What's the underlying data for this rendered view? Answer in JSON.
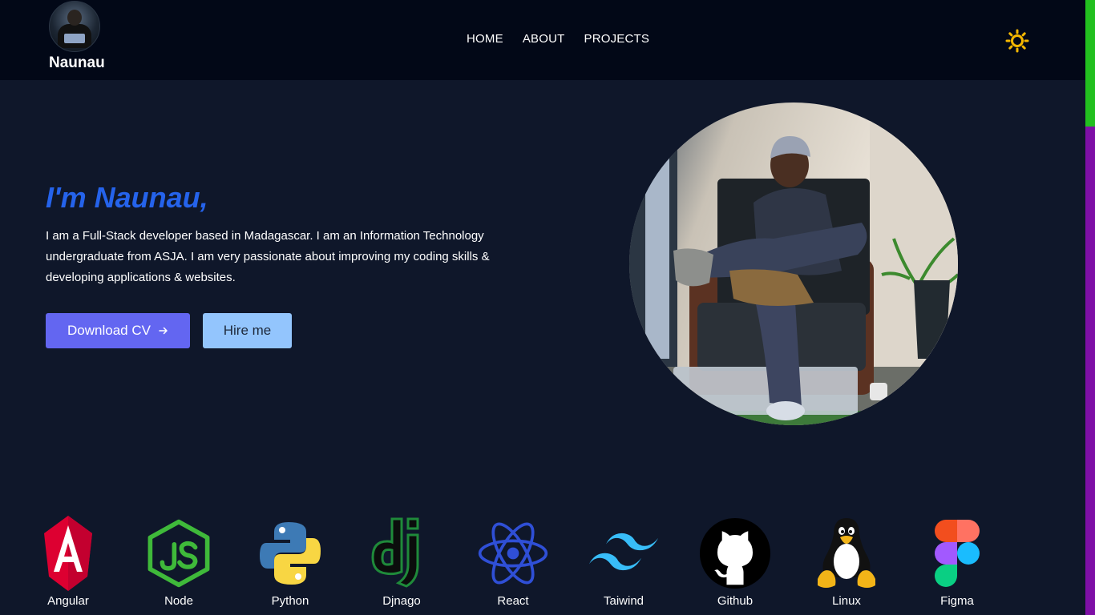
{
  "nav": {
    "brand_name": "Naunau",
    "links": [
      "HOME",
      "ABOUT",
      "PROJECTS"
    ]
  },
  "hero": {
    "title": "I'm Naunau,",
    "description": "I am a Full-Stack developer based in Madagascar. I am an Information Technology undergraduate from ASJA. I am very passionate about improving my coding skills & developing applications & websites.",
    "download_cv_label": "Download CV",
    "download_cv_icon": "arrow-right-icon",
    "hire_label": "Hire me"
  },
  "skills": [
    {
      "label": "Angular",
      "icon": "angular-icon"
    },
    {
      "label": "Node",
      "icon": "nodejs-icon"
    },
    {
      "label": "Python",
      "icon": "python-icon"
    },
    {
      "label": "Djnago",
      "icon": "django-icon"
    },
    {
      "label": "React",
      "icon": "react-icon"
    },
    {
      "label": "Taiwind",
      "icon": "tailwind-icon"
    },
    {
      "label": "Github",
      "icon": "github-icon"
    },
    {
      "label": "Linux",
      "icon": "linux-icon"
    },
    {
      "label": "Figma",
      "icon": "figma-icon"
    }
  ],
  "colors": {
    "background": "#0f172a",
    "navbar": "#020817",
    "accent_title": "#2563eb",
    "primary_button": "#6366f1",
    "secondary_button": "#93c5fd",
    "sun_icon": "#f5b700",
    "scrollbar_thumb": "#22c01f",
    "scrollbar_track": "#7e0fa6"
  }
}
